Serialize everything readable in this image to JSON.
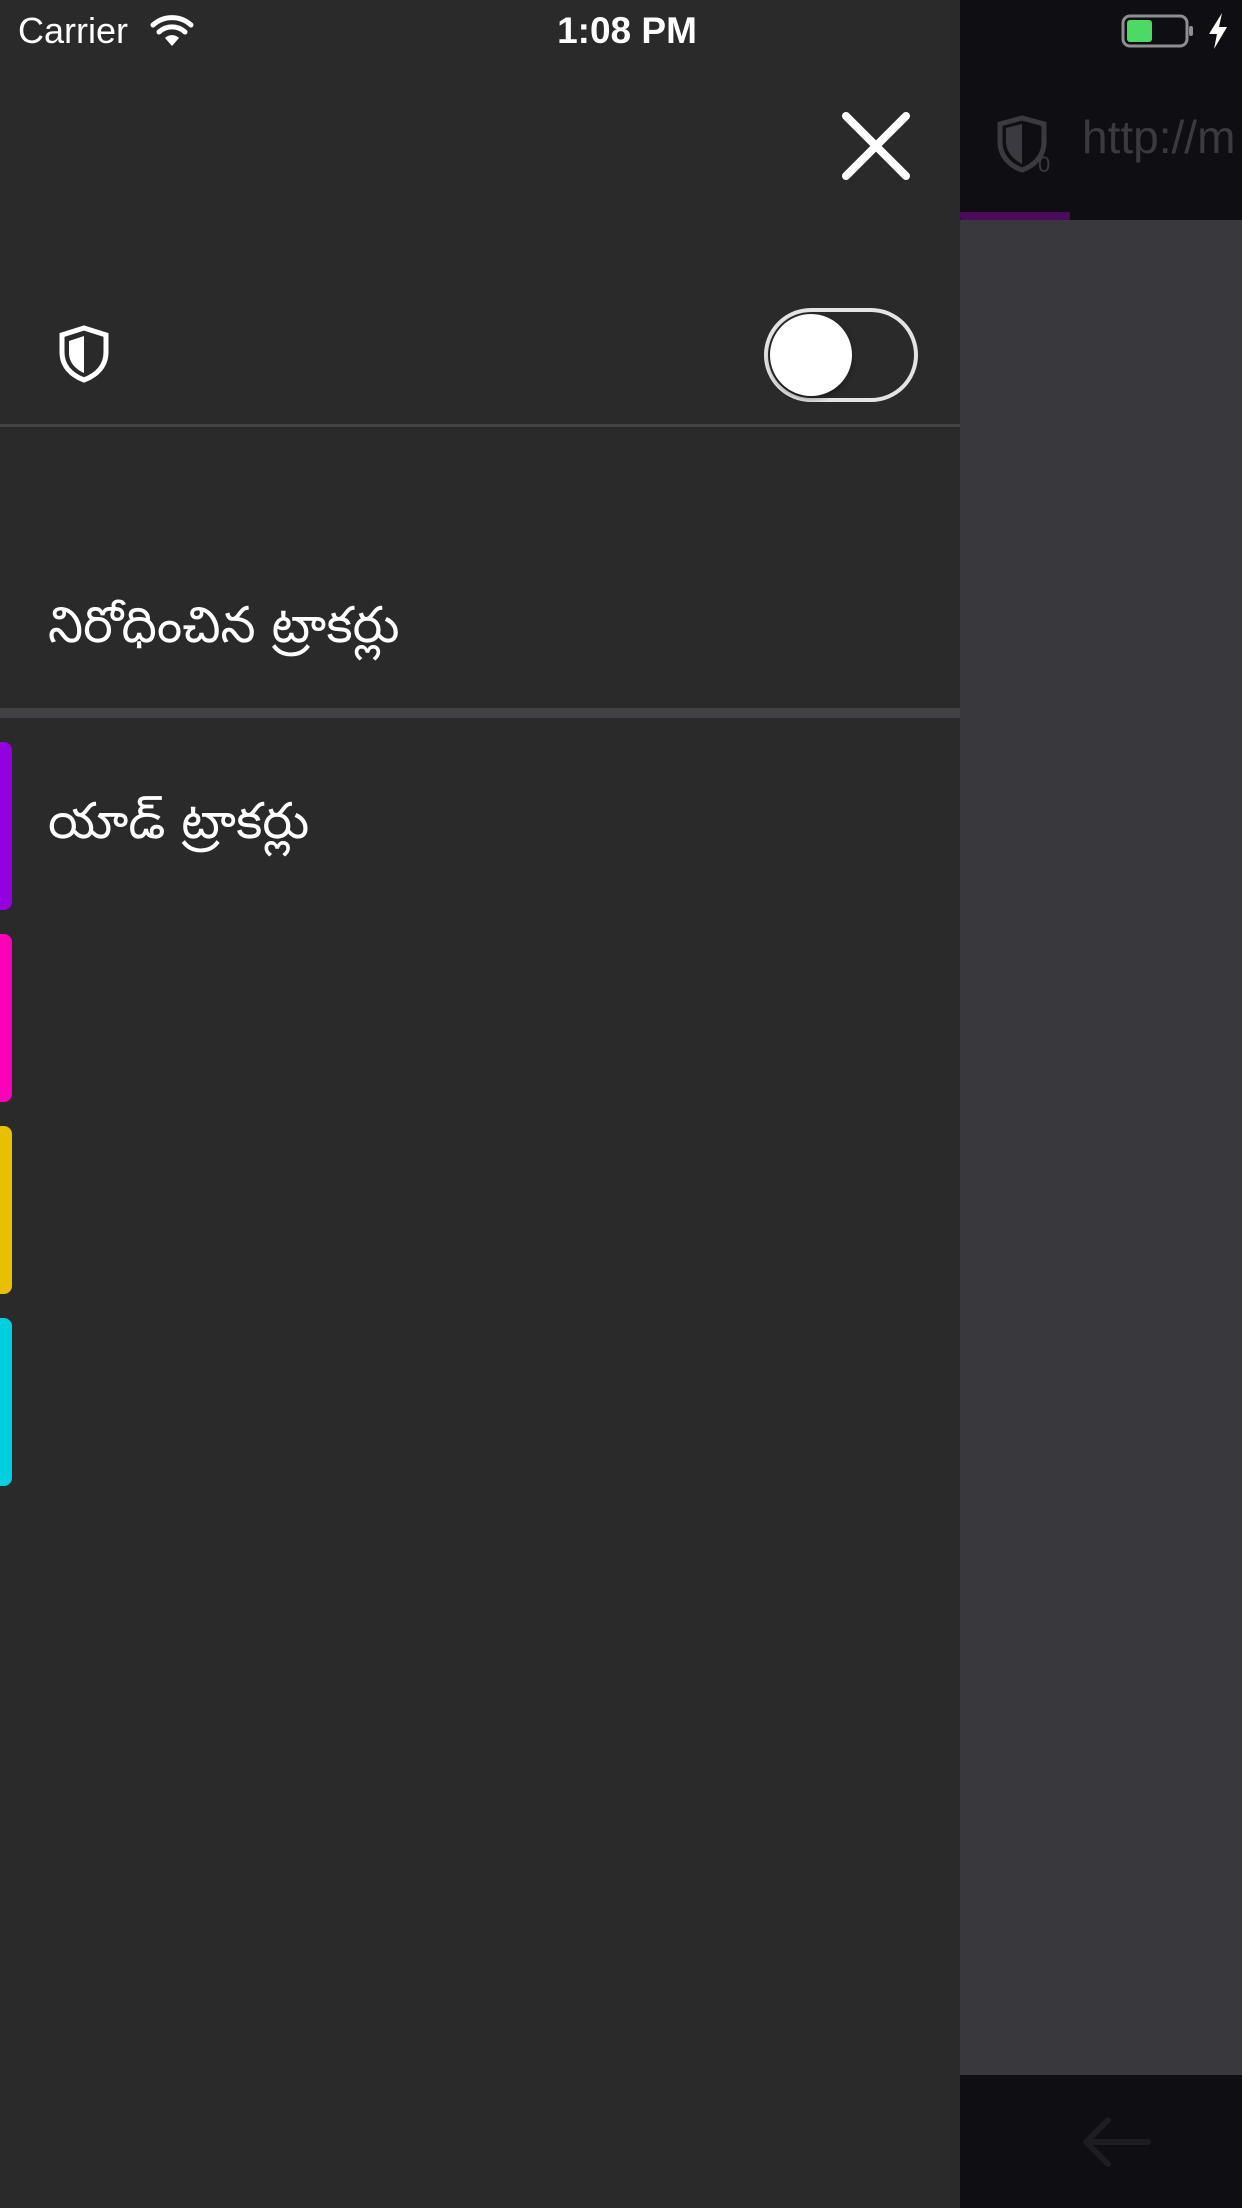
{
  "status_bar": {
    "carrier": "Carrier",
    "time": "1:08 PM"
  },
  "background_browser": {
    "url_text": "http://m"
  },
  "panel": {
    "blocked_trackers_title": "నిరోధించిన ట్రాకర్లు",
    "tracker_categories": [
      {
        "label": "యాడ్ ట్రాకర్లు",
        "color": "#9400e0"
      },
      {
        "label": "",
        "color": "#ff00b8"
      },
      {
        "label": "",
        "color": "#e8c000"
      },
      {
        "label": "",
        "color": "#00cfdf"
      }
    ],
    "toggle_on": false
  },
  "colors": {
    "panel_background": "#2a2a2b",
    "toolbar_background": "#0f0e12",
    "content_background": "#38383d"
  }
}
